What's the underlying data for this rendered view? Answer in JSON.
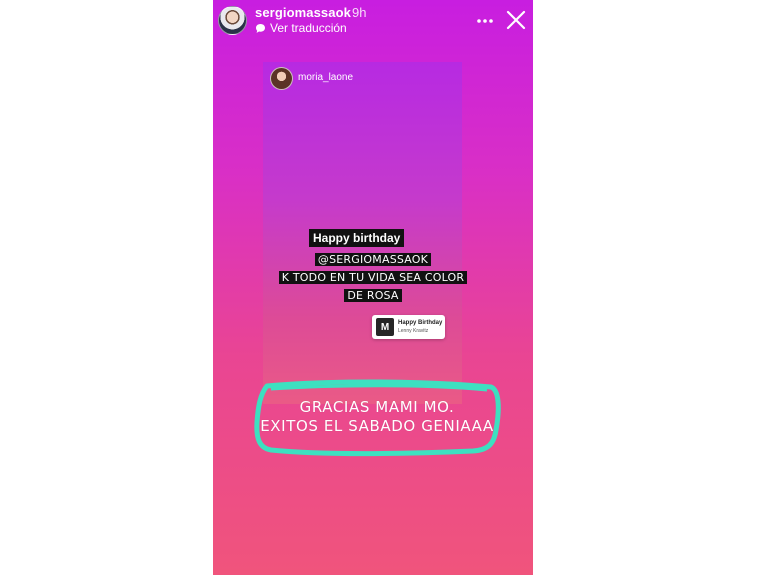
{
  "header": {
    "username": "sergiomassaok",
    "time": "9h",
    "translate_label": "Ver traducción",
    "avatar_icon": "profile-photo",
    "more_icon": "more-dots-icon",
    "close_icon": "close-icon"
  },
  "repost": {
    "username": "moria_laone",
    "sticker_text": "Happy birthday",
    "caption_lines": [
      "@SERGIOMASSAOK",
      "K TODO EN TU VIDA SEA COLOR",
      "DE ROSA"
    ],
    "music": {
      "title": "Happy Birthday",
      "artist": "Lenny Kravitz",
      "art_glyph": "M"
    }
  },
  "message": {
    "lines": [
      "GRACIAS MAMI MO.",
      "EXITOS EL SABADO GENIAAA"
    ]
  },
  "colors": {
    "gradient_top": "#c81ee0",
    "gradient_bottom": "#f0547c",
    "highlight_stroke": "#3de0c0"
  }
}
